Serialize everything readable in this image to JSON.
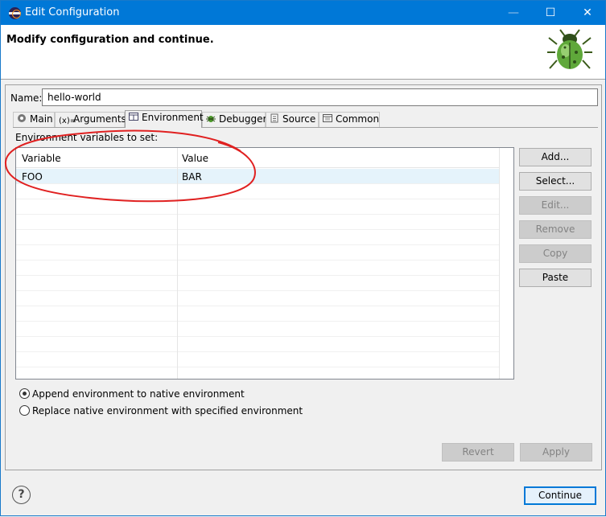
{
  "window": {
    "title": "Edit Configuration",
    "controls": {
      "minimize": "—",
      "maximize": "☐",
      "close": "✕"
    }
  },
  "header": {
    "message": "Modify configuration and continue."
  },
  "name": {
    "label": "Name:",
    "value": "hello-world"
  },
  "tabs": [
    {
      "label": "Main",
      "icon": "main-tab-icon"
    },
    {
      "label": "Arguments",
      "icon": "arguments-icon"
    },
    {
      "label": "Environment",
      "icon": "environment-icon",
      "active": true
    },
    {
      "label": "Debugger",
      "icon": "debugger-bug-icon"
    },
    {
      "label": "Source",
      "icon": "source-icon"
    },
    {
      "label": "Common",
      "icon": "common-icon"
    }
  ],
  "environment": {
    "label": "Environment variables to set:",
    "columns": {
      "variable": "Variable",
      "value": "Value"
    },
    "rows": [
      {
        "variable": "FOO",
        "value": "BAR"
      }
    ]
  },
  "buttons": {
    "add": "Add...",
    "select": "Select...",
    "edit": "Edit...",
    "remove": "Remove",
    "copy": "Copy",
    "paste": "Paste",
    "revert": "Revert",
    "apply": "Apply",
    "continue": "Continue"
  },
  "radios": {
    "append": "Append environment to native environment",
    "replace": "Replace native environment with specified environment",
    "selected": "append"
  },
  "help": "?",
  "annotation_color": "#e02020",
  "accent_color": "#0078d7"
}
